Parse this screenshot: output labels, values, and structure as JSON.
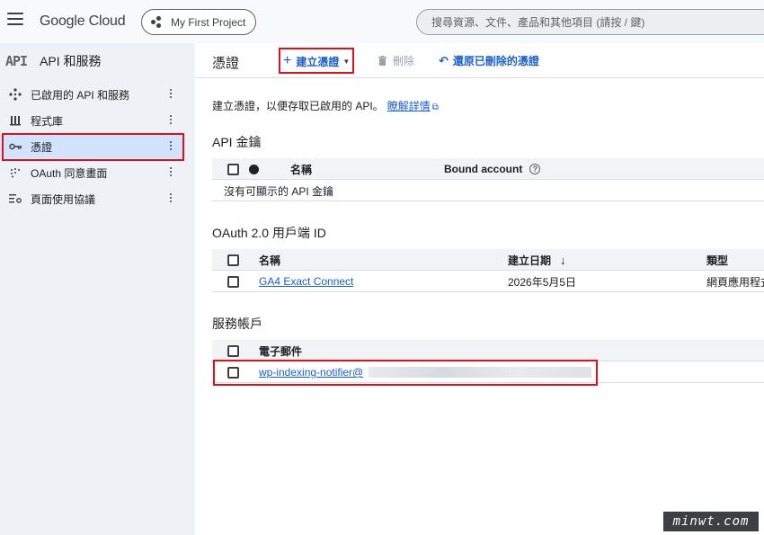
{
  "header": {
    "logo": "Google Cloud",
    "project": "My First Project",
    "search_placeholder": "搜尋資源、文件、產品和其他項目 (請按 / 鍵)"
  },
  "sidebar": {
    "logo_text": "API",
    "title": "API 和服務",
    "items": [
      {
        "label": "已啟用的 API 和服務",
        "icon": "apis-icon"
      },
      {
        "label": "程式庫",
        "icon": "library-icon"
      },
      {
        "label": "憑證",
        "icon": "key-icon",
        "active": true
      },
      {
        "label": "OAuth 同意畫面",
        "icon": "oauth-icon"
      },
      {
        "label": "頁面使用協議",
        "icon": "settings-list-icon"
      }
    ]
  },
  "toolbar": {
    "title": "憑證",
    "create_label": "建立憑證",
    "delete_label": "刪除",
    "restore_label": "還原已刪除的憑證"
  },
  "description": {
    "text": "建立憑證，以便存取已啟用的 API。",
    "link": "瞭解詳情"
  },
  "api_keys": {
    "title": "API 金鑰",
    "columns": [
      "名稱",
      "Bound account"
    ],
    "empty": "沒有可顯示的 API 金鑰"
  },
  "oauth": {
    "title": "OAuth 2.0 用戶端 ID",
    "columns": [
      "名稱",
      "建立日期",
      "類型"
    ],
    "rows": [
      {
        "name": "GA4 Exact Connect",
        "date": "2026年5月5日",
        "type": "網頁應用程式"
      }
    ]
  },
  "service_accounts": {
    "title": "服務帳戶",
    "columns": [
      "電子郵件"
    ],
    "rows": [
      {
        "email": "wp-indexing-notifier@"
      }
    ]
  },
  "watermark": "minwt.com",
  "colors": {
    "highlight": "#e0101a",
    "link": "#1a5fd0",
    "active_nav": "#d3e3fd"
  }
}
